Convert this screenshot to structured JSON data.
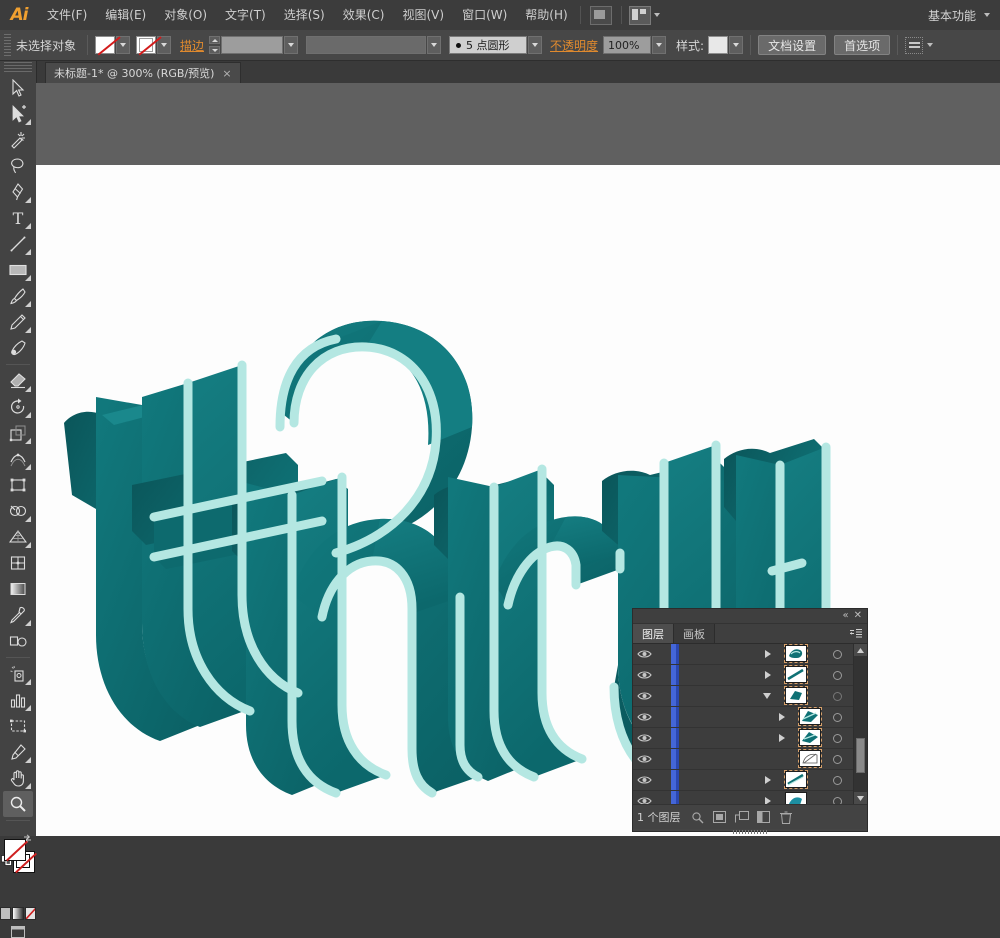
{
  "app": {
    "name": "Adobe Illustrator",
    "logo_text": "Ai"
  },
  "menubar": {
    "items": [
      {
        "label": "文件(F)",
        "name": "menu-file"
      },
      {
        "label": "编辑(E)",
        "name": "menu-edit"
      },
      {
        "label": "对象(O)",
        "name": "menu-object"
      },
      {
        "label": "文字(T)",
        "name": "menu-type"
      },
      {
        "label": "选择(S)",
        "name": "menu-select"
      },
      {
        "label": "效果(C)",
        "name": "menu-effect"
      },
      {
        "label": "视图(V)",
        "name": "menu-view"
      },
      {
        "label": "窗口(W)",
        "name": "menu-window"
      },
      {
        "label": "帮助(H)",
        "name": "menu-help"
      }
    ],
    "workspace": "基本功能"
  },
  "controlbar": {
    "selection_status": "未选择对象",
    "fill_label": "填色",
    "stroke_label": "描边",
    "stroke_weight": "",
    "variable_width": "",
    "stroke_profile": "5 点圆形",
    "opacity_label": "不透明度",
    "opacity_value": "100%",
    "style_label": "样式:",
    "document_setup": "文档设置",
    "preferences": "首选项"
  },
  "document": {
    "tab_title": "未标题-1* @ 300% (RGB/预览)",
    "close_glyph": "×",
    "zoom": "300%",
    "color_mode": "RGB",
    "view_mode": "预览"
  },
  "toolbar": {
    "tools": [
      {
        "name": "selection-tool",
        "label": "选择工具",
        "has_flyout": false,
        "selected": false
      },
      {
        "name": "direct-selection-tool",
        "label": "直接选择工具",
        "has_flyout": true,
        "selected": false
      },
      {
        "name": "magic-wand-tool",
        "label": "魔棒工具",
        "has_flyout": false,
        "selected": false
      },
      {
        "name": "lasso-tool",
        "label": "套索工具",
        "has_flyout": false,
        "selected": false
      },
      {
        "name": "pen-tool",
        "label": "钢笔工具",
        "has_flyout": true,
        "selected": false
      },
      {
        "name": "type-tool",
        "label": "文字工具",
        "has_flyout": true,
        "selected": false
      },
      {
        "name": "line-segment-tool",
        "label": "直线段工具",
        "has_flyout": true,
        "selected": false
      },
      {
        "name": "rectangle-tool",
        "label": "矩形工具",
        "has_flyout": true,
        "selected": false
      },
      {
        "name": "paintbrush-tool",
        "label": "画笔工具",
        "has_flyout": true,
        "selected": false
      },
      {
        "name": "pencil-tool",
        "label": "铅笔工具",
        "has_flyout": true,
        "selected": false
      },
      {
        "name": "blob-brush-tool",
        "label": "斑点画笔工具",
        "has_flyout": false,
        "selected": false
      },
      {
        "name": "eraser-tool",
        "label": "橡皮擦工具",
        "has_flyout": true,
        "selected": false
      },
      {
        "name": "rotate-tool",
        "label": "旋转工具",
        "has_flyout": true,
        "selected": false
      },
      {
        "name": "scale-tool",
        "label": "比例缩放工具",
        "has_flyout": true,
        "selected": false
      },
      {
        "name": "width-tool",
        "label": "宽度工具",
        "has_flyout": true,
        "selected": false
      },
      {
        "name": "free-transform-tool",
        "label": "自由变换工具",
        "has_flyout": false,
        "selected": false
      },
      {
        "name": "shape-builder-tool",
        "label": "形状生成器工具",
        "has_flyout": true,
        "selected": false
      },
      {
        "name": "perspective-grid-tool",
        "label": "透视网格工具",
        "has_flyout": true,
        "selected": false
      },
      {
        "name": "mesh-tool",
        "label": "网格工具",
        "has_flyout": false,
        "selected": false
      },
      {
        "name": "gradient-tool",
        "label": "渐变工具",
        "has_flyout": false,
        "selected": false
      },
      {
        "name": "eyedropper-tool",
        "label": "吸管工具",
        "has_flyout": true,
        "selected": false
      },
      {
        "name": "blend-tool",
        "label": "混合工具",
        "has_flyout": false,
        "selected": false
      },
      {
        "name": "symbol-sprayer-tool",
        "label": "符号喷枪工具",
        "has_flyout": true,
        "selected": false
      },
      {
        "name": "column-graph-tool",
        "label": "柱形图工具",
        "has_flyout": true,
        "selected": false
      },
      {
        "name": "artboard-tool",
        "label": "画板工具",
        "has_flyout": false,
        "selected": false
      },
      {
        "name": "slice-tool",
        "label": "切片工具",
        "has_flyout": true,
        "selected": false
      },
      {
        "name": "hand-tool",
        "label": "抓手工具",
        "has_flyout": true,
        "selected": false
      },
      {
        "name": "zoom-tool",
        "label": "缩放工具",
        "has_flyout": false,
        "selected": true
      }
    ],
    "fill_state": "无",
    "stroke_state": "无"
  },
  "artwork": {
    "text": "thru",
    "face_color": "#0f7175",
    "face_color_dark": "#0b5a5e",
    "face_color_light": "#178a8d",
    "outline_color": "#b4e7e2",
    "background": "#fdfdfd"
  },
  "layers_panel": {
    "tabs": [
      {
        "label": "图层",
        "name": "tab-layers",
        "active": true
      },
      {
        "label": "画板",
        "name": "tab-artboards",
        "active": false
      }
    ],
    "rows": [
      {
        "indent": 0,
        "triangle": "closed",
        "thumb": "shape",
        "visible": true,
        "selected": true
      },
      {
        "indent": 0,
        "triangle": "closed",
        "thumb": "line",
        "visible": true,
        "selected": true
      },
      {
        "indent": 0,
        "triangle": "open",
        "thumb": "shape",
        "visible": true,
        "selected": true
      },
      {
        "indent": 1,
        "triangle": "closed",
        "thumb": "shape",
        "visible": true,
        "selected": true
      },
      {
        "indent": 1,
        "triangle": "closed",
        "thumb": "shape",
        "visible": true,
        "selected": true
      },
      {
        "indent": 1,
        "triangle": "none",
        "thumb": "white",
        "visible": true,
        "selected": true
      },
      {
        "indent": 0,
        "triangle": "closed",
        "thumb": "line",
        "visible": true,
        "selected": true
      },
      {
        "indent": 0,
        "triangle": "closed",
        "thumb": "shape",
        "visible": true,
        "selected": false
      }
    ],
    "footer_count": "1 个图层",
    "footer_buttons": [
      {
        "name": "locate-object-button",
        "label": "定位对象"
      },
      {
        "name": "make-clipping-mask-button",
        "label": "建立/释放剪切蒙版"
      },
      {
        "name": "create-new-sublayer-button",
        "label": "创建新子图层"
      },
      {
        "name": "create-new-layer-button",
        "label": "创建新图层"
      },
      {
        "name": "delete-selection-button",
        "label": "删除所选图层"
      }
    ],
    "scrollbar": {
      "thumb_top_pct": 60,
      "thumb_height_pct": 26
    }
  }
}
